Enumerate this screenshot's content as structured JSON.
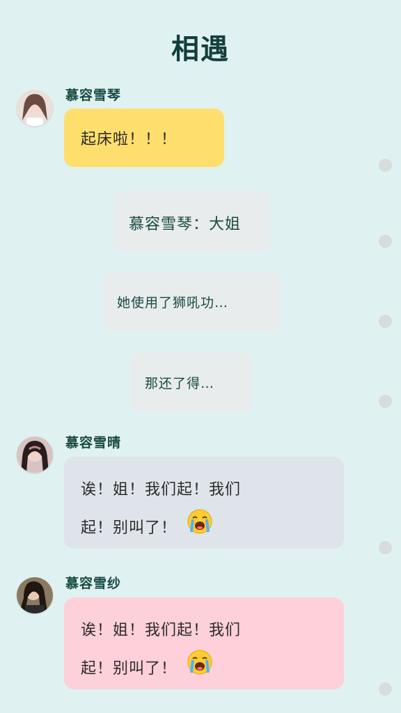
{
  "title": "相遇",
  "messages": [
    {
      "sender": "慕容雪琴",
      "text": "起床啦！！！"
    },
    {
      "text": "慕容雪琴：大姐"
    },
    {
      "text": "她使用了狮吼功…"
    },
    {
      "text": "那还了得…"
    },
    {
      "sender": "慕容雪晴",
      "line1": "诶！姐！我们起！我们",
      "line2": "起！别叫了！",
      "emoji": "loudly-crying-face-icon"
    },
    {
      "sender": "慕容雪纱",
      "line1": "诶！姐！我们起！我们",
      "line2": "起！别叫了！",
      "emoji": "loudly-crying-face-icon"
    }
  ],
  "colors": {
    "background": "#e0f1f1",
    "title": "#123f3a",
    "bubble_yellow": "#fedf6e",
    "bubble_grey": "#e9ecec",
    "bubble_blue": "#dfe4ea",
    "bubble_pink": "#fed0d9"
  }
}
